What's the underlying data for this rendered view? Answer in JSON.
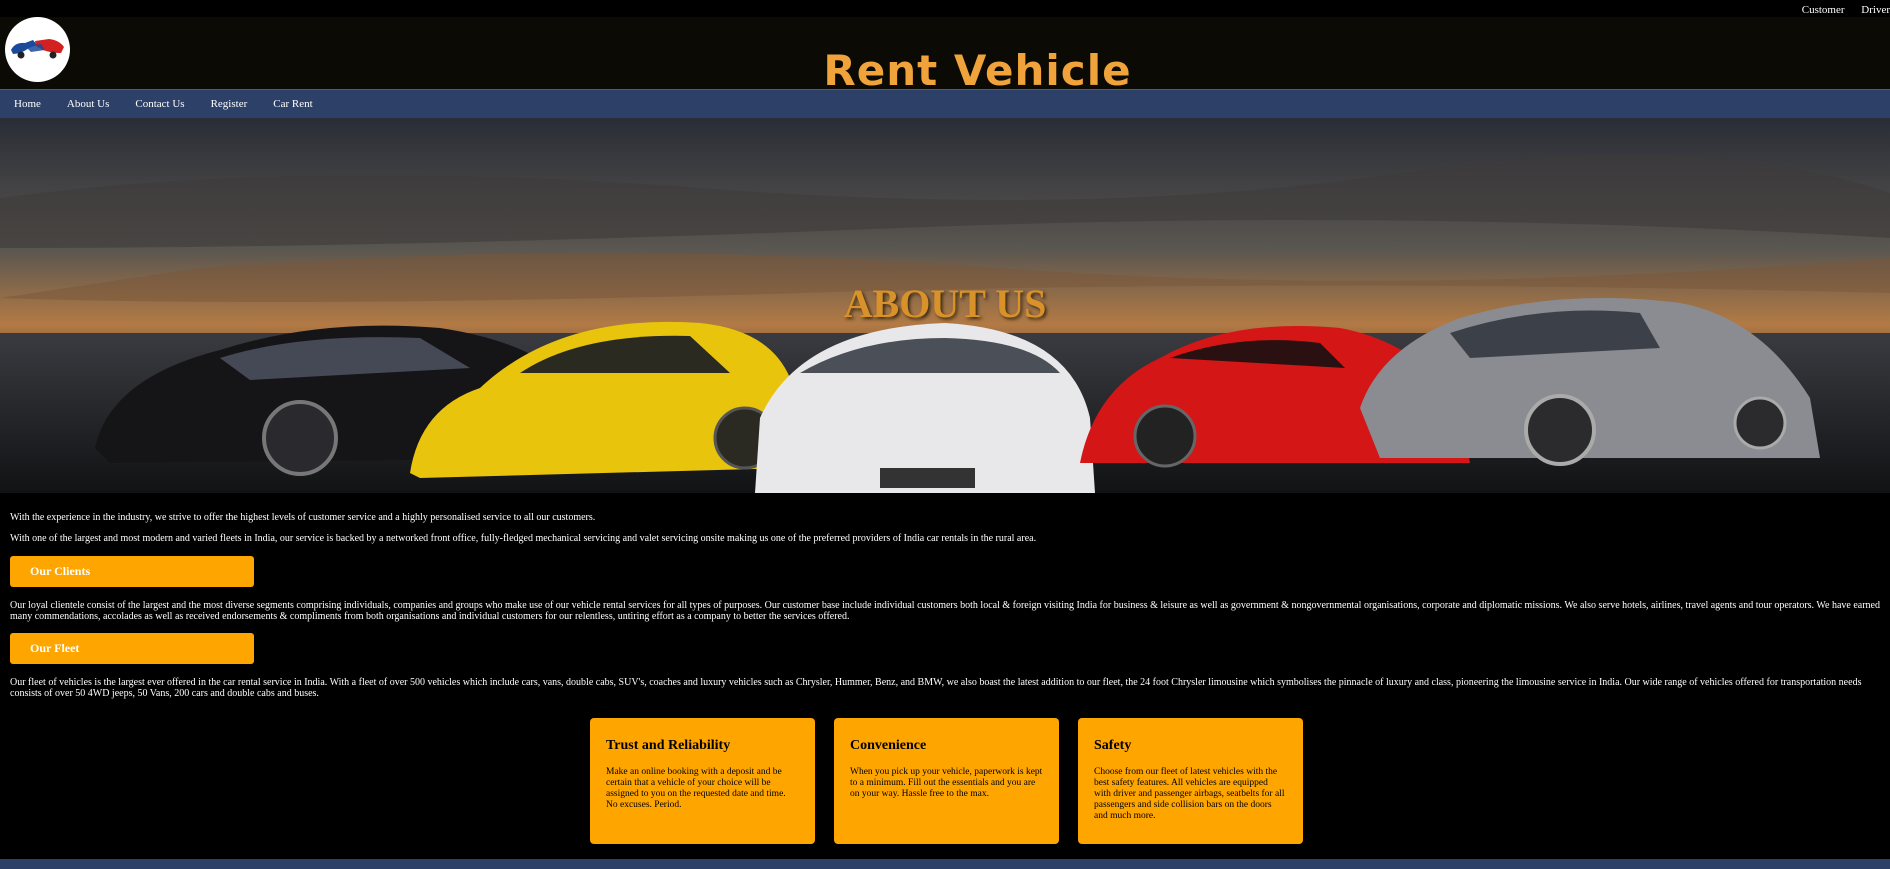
{
  "top_links": [
    "Customer",
    "Driver"
  ],
  "brand": {
    "title": "Rent Vehicle",
    "logo_icon": "car-handshake-icon"
  },
  "nav": [
    "Home",
    "About Us",
    "Contact Us",
    "Register",
    "Car Rent"
  ],
  "hero": {
    "title": "ABOUT US"
  },
  "intro": {
    "p1": "With the experience in the industry, we strive to offer the highest levels of customer service and a highly personalised service to all our customers.",
    "p2": "With one of the largest and most modern and varied fleets in India, our service is backed by a networked front office, fully-fledged mechanical servicing and valet servicing onsite making us one of the preferred providers of India car rentals in the rural area."
  },
  "clients": {
    "label": "Our Clients",
    "text": "Our loyal clientele consist of the largest and the most diverse segments comprising individuals, companies and groups who make use of our vehicle rental services for all types of purposes. Our customer base include individual customers both local & foreign visiting India for business & leisure as well as government & nongovernmental organisations, corporate and diplomatic missions. We also serve hotels, airlines, travel agents and tour operators. We have earned many commendations, accolades as well as received endorsements & compliments from both organisations and individual customers for our relentless, untiring effort as a company to better the services offered."
  },
  "fleet": {
    "label": "Our Fleet",
    "text": "Our fleet of vehicles is the largest ever offered in the car rental service in India. With a fleet of over 500 vehicles which include cars, vans, double cabs, SUV's, coaches and luxury vehicles such as Chrysler, Hummer, Benz, and BMW, we also boast the latest addition to our fleet, the 24 foot Chrysler limousine which symbolises the pinnacle of luxury and class, pioneering the limousine service in India. Our wide range of vehicles offered for transportation needs consists of over 50 4WD jeeps, 50 Vans, 200 cars and double cabs and buses."
  },
  "cards": [
    {
      "title": "Trust and Reliability",
      "text": "Make an online booking with a deposit and be certain that a vehicle of your choice will be assigned to you on the requested date and time. No excuses. Period."
    },
    {
      "title": "Convenience",
      "text": "When you pick up your vehicle, paperwork is kept to a minimum. Fill out the essentials and you are on your way. Hassle free to the max."
    },
    {
      "title": "Safety",
      "text": "Choose from our fleet of latest vehicles with the best safety features. All vehicles are equipped with driver and passenger airbags, seatbelts for all passengers and side collision bars on the doors and much more."
    }
  ],
  "colors": {
    "accent": "#ffa500",
    "nav": "#2c4068",
    "title": "#f0a33a"
  }
}
